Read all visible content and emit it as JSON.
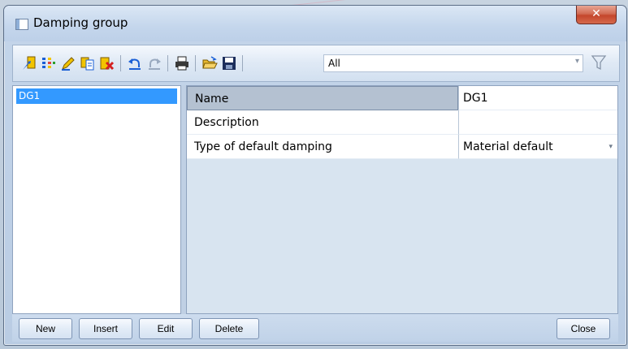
{
  "window": {
    "title": "Damping group",
    "close_glyph": "✕"
  },
  "toolbar": {
    "icons": [
      "new-item-icon",
      "columns-icon",
      "edit-pen-icon",
      "copy-icon",
      "delete-icon",
      "undo-icon",
      "redo-icon",
      "print-icon",
      "open-folder-icon",
      "save-icon"
    ],
    "filter_value": "All",
    "filter_arrow": "▾"
  },
  "list": {
    "items": [
      "DG1"
    ]
  },
  "properties": [
    {
      "name": "Name",
      "value": "DG1"
    },
    {
      "name": "Description",
      "value": ""
    },
    {
      "name": "Type of default damping",
      "value": "Material default",
      "dropdown": "▾"
    }
  ],
  "buttons": {
    "new": "New",
    "insert": "Insert",
    "edit": "Edit",
    "delete": "Delete",
    "close": "Close"
  },
  "colors": {
    "selection": "#3399ff",
    "close_red": "#c4462c",
    "panel_bg": "#d8e4f0"
  }
}
